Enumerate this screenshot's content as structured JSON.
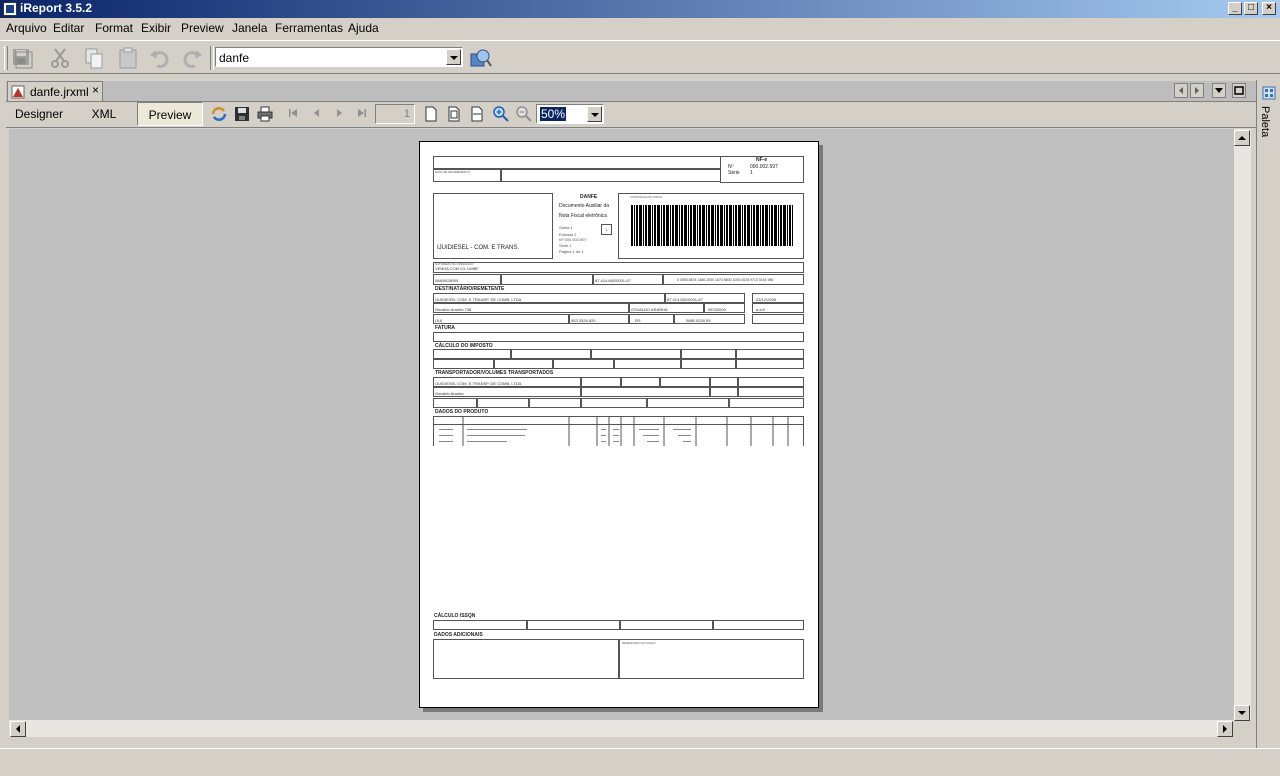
{
  "window": {
    "title": "iReport 3.5.2"
  },
  "menu": [
    "Arquivo",
    "Editar",
    "Format",
    "Exibir",
    "Preview",
    "Janela",
    "Ferramentas",
    "Ajuda"
  ],
  "toolbar": {
    "report_combo_value": "danfe"
  },
  "document_tab": {
    "label": "danfe.jrxml",
    "close": "×"
  },
  "view_tabs": [
    "Designer",
    "XML",
    "Preview"
  ],
  "preview_toolbar": {
    "page_number": "1",
    "zoom": "50%"
  },
  "side_panel": {
    "label": "Paleta"
  },
  "report": {
    "nfe_title": "NF-e",
    "nfe_no_label": "Nº",
    "nfe_no_value": "000.002.597",
    "serie_label": "Série",
    "serie_value": "1",
    "receipt_label": "DATA DE RECEBIMENTO",
    "emitter": "IJUIDIESEL - COM. E TRANS.",
    "danfe_title": "DANFE",
    "danfe_sub1": "Documento Auxiliar da",
    "danfe_sub2": "Nota Fiscal eletrônica",
    "saida": "Saída  1",
    "entrada": "Entrada  2",
    "danfe_no": "Nº     000.002.597",
    "danfe_serie": "Série   1",
    "danfe_page": "Página 1 de 1",
    "danfe_box": "1",
    "controle_label": "CONTROLE DO FISCO",
    "natureza_label": "NATUREZA DA OPERAÇÃO",
    "natureza_value": "VENDA COM ICL UMBF",
    "ie_value": "088/0028009",
    "cnpj_value": "87.414.662/0001-67",
    "chave_value": "4 3090 6874 1466 2000 1670 5500 1000 0025 9710 0191 980",
    "sec_dest": "DESTINATÁRIO/REMETENTE",
    "dest_name": "IJUIDIESEL COM. E TRANSP. DE COMB. LTDA",
    "dest_cnpj": "87.414.662/0001-67",
    "dest_date": "03/12/2008",
    "dest_addr": "Osvaldo Aranha 738",
    "dest_bairro": "OSVALDO ARANHA",
    "dest_cep": "98700000",
    "dest_hora": "a a:0",
    "dest_city": "IJUI",
    "dest_phone": "553 3328 820",
    "dest_uf": "RS",
    "dest_ie": "0880 0028 09",
    "sec_fatura": "FATURA",
    "sec_imposto": "CÁLCULO DO IMPOSTO",
    "sec_transp": "TRANSPORTADOR/VOLUMES TRANSPORTADOS",
    "transp_name": "IJUIDIESEL COM. E TRANSP. DE COMB. LTDA",
    "transp_addr": "Osvaldo Aranha",
    "sec_produtos": "DADOS DO PRODUTO",
    "sec_issqn": "CÁLCULO ISSQN",
    "sec_adicionais": "DADOS ADICIONAIS",
    "fisco_label": "RESERVADO AO FISCO"
  }
}
